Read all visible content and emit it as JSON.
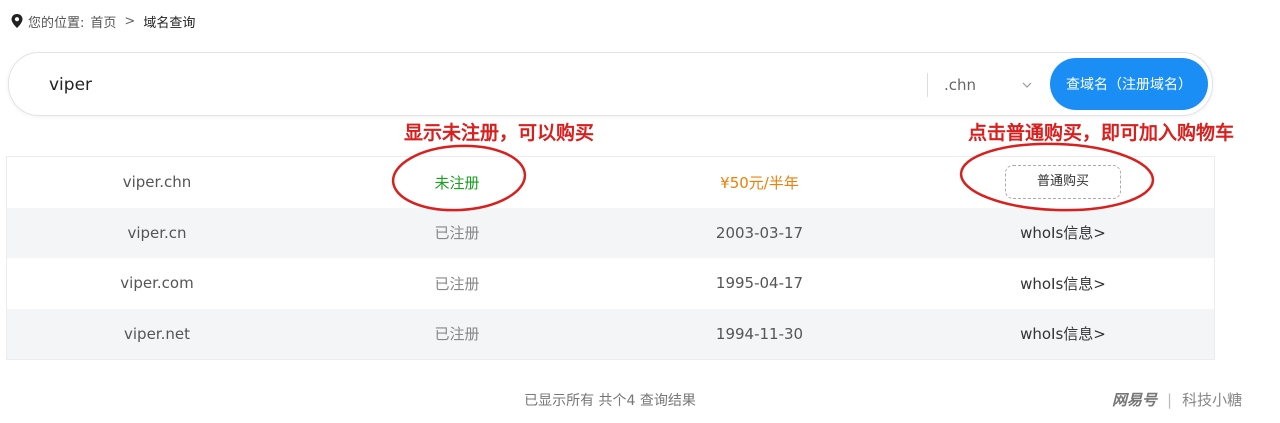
{
  "breadcrumb": {
    "prefix": "您的位置:",
    "home": "首页",
    "separator": ">",
    "current": "域名查询",
    "icon": "location-pin-icon"
  },
  "search": {
    "value": "viper",
    "suffix": ".chn",
    "button_label": "查域名（注册域名）"
  },
  "annotations": {
    "left": "显示未注册，可以购买",
    "right": "点击普通购买，即可加入购物车",
    "circle_color": "#d8201f"
  },
  "results": [
    {
      "domain": "viper.chn",
      "status": "未注册",
      "info": "¥50元/半年",
      "action": "普通购买"
    },
    {
      "domain": "viper.cn",
      "status": "已注册",
      "info": "2003-03-17",
      "action": "whoIs信息>"
    },
    {
      "domain": "viper.com",
      "status": "已注册",
      "info": "1995-04-17",
      "action": "whoIs信息>"
    },
    {
      "domain": "viper.net",
      "status": "已注册",
      "info": "1994-11-30",
      "action": "whoIs信息>"
    }
  ],
  "summary": "已显示所有 共个4 查询结果",
  "watermark": {
    "brand": "网易号",
    "separator": "|",
    "author": "科技小糖"
  },
  "colors": {
    "accent": "#1a8ef5",
    "available": "#17a01e",
    "price": "#f07e05",
    "annotation": "#d8201f"
  }
}
